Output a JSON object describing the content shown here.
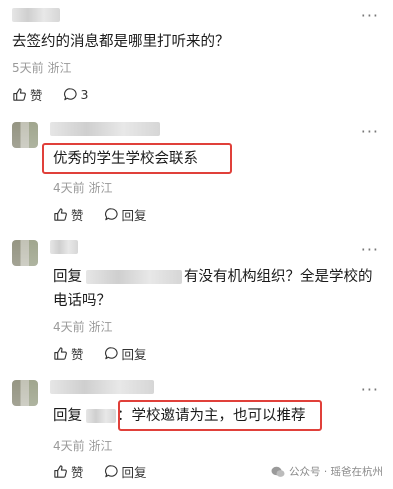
{
  "comments": [
    {
      "text": "去签约的消息都是哪里打听来的？",
      "meta": "5天前 浙江",
      "like_label": "赞",
      "reply_count": "3"
    },
    {
      "text": "优秀的学生学校会联系",
      "meta": "4天前 浙江",
      "like_label": "赞",
      "reply_label": "回复"
    },
    {
      "reply_prefix": "回复",
      "text_line1": "有没有机构组织？全是学校的",
      "text_line2": "电话吗？",
      "meta": "4天前 浙江",
      "like_label": "赞",
      "reply_label": "回复"
    },
    {
      "reply_prefix": "回复",
      "text": "：学校邀请为主，也可以推荐",
      "meta": "4天前 浙江",
      "like_label": "赞",
      "reply_label": "回复"
    }
  ],
  "more_label": "···",
  "watermark": {
    "text": "公众号 · 瑶爸在杭州"
  }
}
